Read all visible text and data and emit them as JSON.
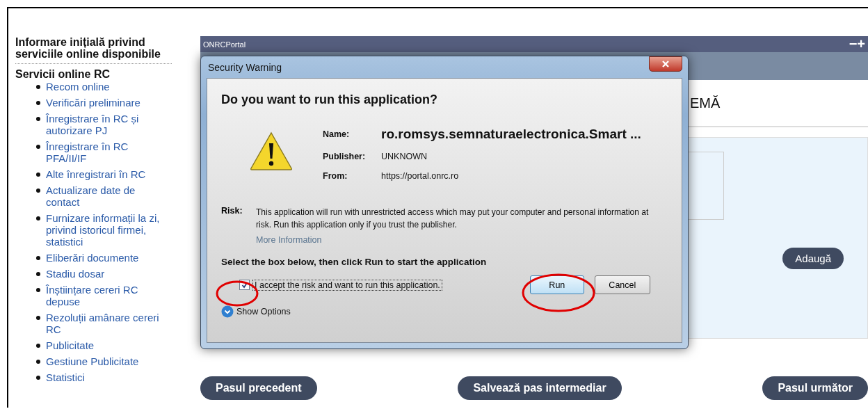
{
  "sidebar": {
    "title": "Informare inițială privind serviciile online disponibile",
    "section": "Servicii online RC",
    "items": [
      {
        "label": "Recom online"
      },
      {
        "label": "Verificări preliminare"
      },
      {
        "label": "Înregistrare în RC și autorizare PJ"
      },
      {
        "label": "Înregistrare în RC PFA/II/IF"
      },
      {
        "label": "Alte înregistrari în RC"
      },
      {
        "label": "Actualizare date de contact"
      },
      {
        "label": "Furnizare informații la zi, privind istoricul firmei, statistici"
      },
      {
        "label": "Eliberări documente"
      },
      {
        "label": "Stadiu dosar"
      },
      {
        "label": "Înștiințare cereri RC depuse"
      },
      {
        "label": "Rezoluții amânare cereri RC"
      },
      {
        "label": "Publicitate"
      },
      {
        "label": "Gestiune Publicitate"
      },
      {
        "label": "Statistici"
      }
    ]
  },
  "portal": {
    "title": "ONRCPortal",
    "window_controls": [
      "−",
      "+"
    ],
    "heading": "EMĂ",
    "add_button": "Adaugă",
    "buttons": [
      "Pasul precedent",
      "Salvează pas intermediar",
      "Pasul următor"
    ]
  },
  "dialog": {
    "title": "Security Warning",
    "question": "Do you want to run this application?",
    "details": [
      {
        "label": "Name:",
        "value": "ro.romsys.semnaturaelectronica.Smart ...",
        "kind": "name"
      },
      {
        "label": "Publisher:",
        "value": "UNKNOWN",
        "kind": "plain"
      },
      {
        "label": "From:",
        "value": "https://portal.onrc.ro",
        "kind": "plain"
      }
    ],
    "risk_label": "Risk:",
    "risk_text": "This application will run with unrestricted access which may put your computer and personal information at risk. Run this application only if you trust the publisher.",
    "more_info": "More Information",
    "instruction": "Select the box below, then click Run to start the application",
    "accept": {
      "label": "I accept the risk and want to run this application.",
      "checked": true
    },
    "run_button": "Run",
    "cancel_button": "Cancel",
    "show_options": "Show Options"
  }
}
